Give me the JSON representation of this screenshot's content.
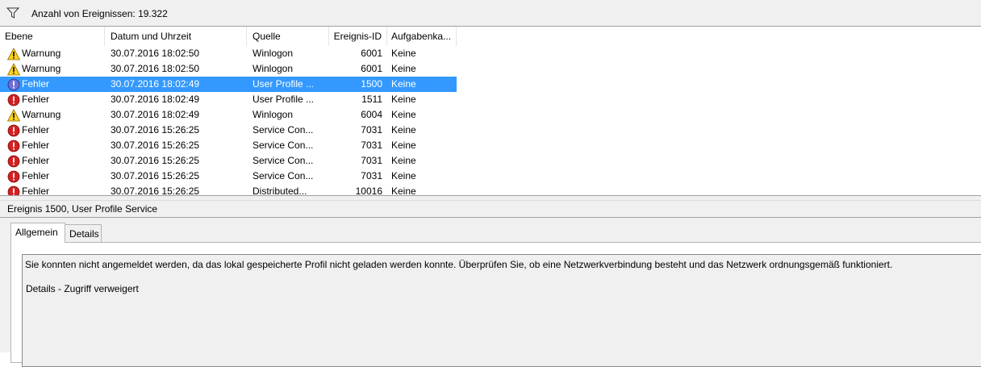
{
  "filter": {
    "icon": "filter-icon",
    "count_text": "Anzahl von Ereignissen: 19.322"
  },
  "columns": {
    "level": "Ebene",
    "datetime": "Datum und Uhrzeit",
    "source": "Quelle",
    "event_id": "Ereignis-ID",
    "task": "Aufgabenka..."
  },
  "events": [
    {
      "level": "Warnung",
      "icon": "warning-icon",
      "datetime": "30.07.2016 18:02:50",
      "source": "Winlogon",
      "event_id": "6001",
      "task": "Keine",
      "selected": false
    },
    {
      "level": "Warnung",
      "icon": "warning-icon",
      "datetime": "30.07.2016 18:02:50",
      "source": "Winlogon",
      "event_id": "6001",
      "task": "Keine",
      "selected": false
    },
    {
      "level": "Fehler",
      "icon": "error-icon",
      "datetime": "30.07.2016 18:02:49",
      "source": "User Profile ...",
      "event_id": "1500",
      "task": "Keine",
      "selected": true
    },
    {
      "level": "Fehler",
      "icon": "error-icon",
      "datetime": "30.07.2016 18:02:49",
      "source": "User Profile ...",
      "event_id": "1511",
      "task": "Keine",
      "selected": false
    },
    {
      "level": "Warnung",
      "icon": "warning-icon",
      "datetime": "30.07.2016 18:02:49",
      "source": "Winlogon",
      "event_id": "6004",
      "task": "Keine",
      "selected": false
    },
    {
      "level": "Fehler",
      "icon": "error-icon",
      "datetime": "30.07.2016 15:26:25",
      "source": "Service Con...",
      "event_id": "7031",
      "task": "Keine",
      "selected": false
    },
    {
      "level": "Fehler",
      "icon": "error-icon",
      "datetime": "30.07.2016 15:26:25",
      "source": "Service Con...",
      "event_id": "7031",
      "task": "Keine",
      "selected": false
    },
    {
      "level": "Fehler",
      "icon": "error-icon",
      "datetime": "30.07.2016 15:26:25",
      "source": "Service Con...",
      "event_id": "7031",
      "task": "Keine",
      "selected": false
    },
    {
      "level": "Fehler",
      "icon": "error-icon",
      "datetime": "30.07.2016 15:26:25",
      "source": "Service Con...",
      "event_id": "7031",
      "task": "Keine",
      "selected": false
    },
    {
      "level": "Fehler",
      "icon": "error-icon",
      "datetime": "30.07.2016 15:26:25",
      "source": "Distributed...",
      "event_id": "10016",
      "task": "Keine",
      "selected": false
    }
  ],
  "detail": {
    "title": "Ereignis 1500, User Profile Service",
    "tabs": [
      "Allgemein",
      "Details"
    ],
    "active_tab": "Allgemein",
    "message": "Sie konnten nicht angemeldet werden, da das lokal gespeicherte Profil nicht geladen werden konnte. Überprüfen Sie, ob eine Netzwerkverbindung besteht und das Netzwerk ordnungsgemäß funktioniert.",
    "details_line": "Details - Zugriff verweigert"
  },
  "colors": {
    "selection": "#3399ff",
    "warning": "#ffd21f",
    "error": "#d42020"
  }
}
